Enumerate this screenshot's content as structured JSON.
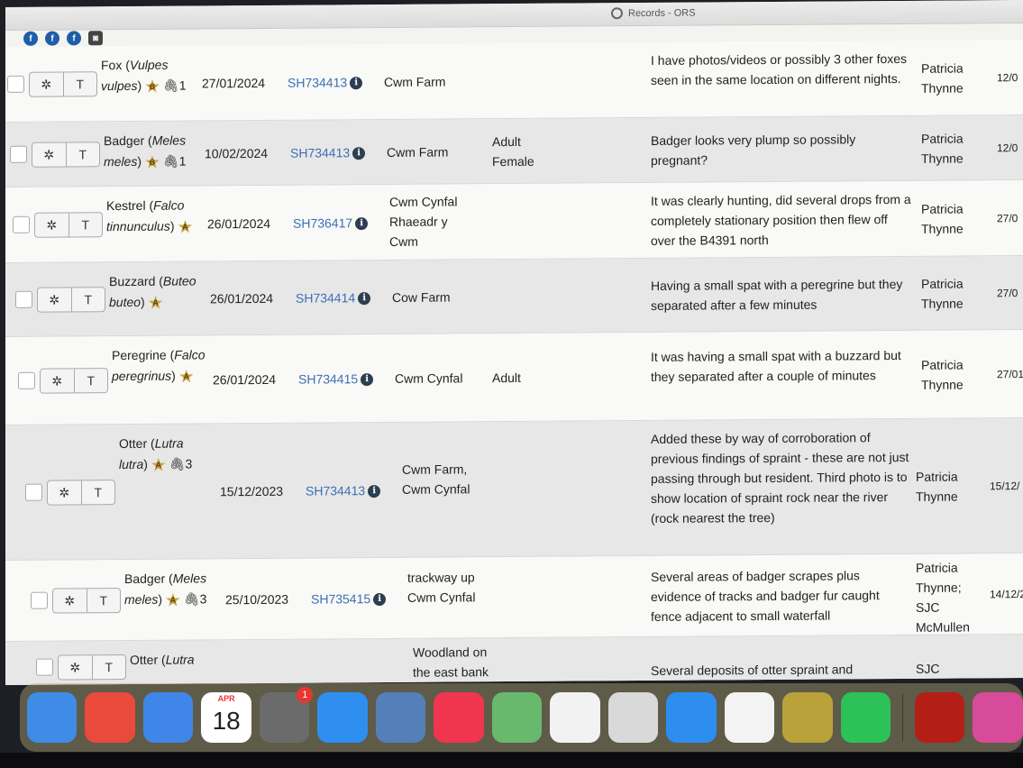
{
  "window": {
    "title": "Records - ORS"
  },
  "tabs": [
    {
      "icon": "circle-f-icon",
      "label": "f"
    },
    {
      "icon": "circle-f-icon",
      "label": "f"
    },
    {
      "icon": "circle-f-icon",
      "label": "f"
    },
    {
      "icon": "square-app-icon",
      "label": "◙"
    }
  ],
  "rows": [
    {
      "species_common": "Fox",
      "species_latin": "Vulpes vulpes",
      "rating": "B",
      "attachments": "1",
      "date": "27/01/2024",
      "gridref": "SH734413",
      "location": "Cwm Farm",
      "stage": "",
      "comment": "I have photos/videos or possibly 3 other foxes seen in the same location on different nights.",
      "recorder": "Patricia Thynne",
      "entered": "12/0"
    },
    {
      "species_common": "Badger",
      "species_latin": "Meles meles",
      "rating": "B",
      "attachments": "1",
      "date": "10/02/2024",
      "gridref": "SH734413",
      "location": "Cwm Farm",
      "stage": "Adult Female",
      "comment": "Badger looks very plump so possibly pregnant?",
      "recorder": "Patricia Thynne",
      "entered": "12/0"
    },
    {
      "species_common": "Kestrel",
      "species_latin": "Falco tinnunculus",
      "rating": "A",
      "attachments": "",
      "date": "26/01/2024",
      "gridref": "SH736417",
      "location": "Cwm Cynfal Rhaeadr y Cwm",
      "stage": "",
      "comment": "It was clearly hunting, did several drops from a completely stationary position then flew off over the B4391 north",
      "recorder": "Patricia Thynne",
      "entered": "27/0"
    },
    {
      "species_common": "Buzzard",
      "species_latin": "Buteo buteo",
      "rating": "A",
      "attachments": "",
      "date": "26/01/2024",
      "gridref": "SH734414",
      "location": "Cow Farm",
      "stage": "",
      "comment": "Having a small spat with a peregrine but they separated after a few minutes",
      "recorder": "Patricia Thynne",
      "entered": "27/0"
    },
    {
      "species_common": "Peregrine",
      "species_latin": "Falco peregrinus",
      "rating": "A",
      "attachments": "",
      "date": "26/01/2024",
      "gridref": "SH734415",
      "location": "Cwm Cynfal",
      "stage": "Adult",
      "comment": "It was having a small spat with a buzzard but they separated after a couple of minutes",
      "recorder": "Patricia Thynne",
      "entered": "27/01"
    },
    {
      "species_common": "Otter",
      "species_latin": "Lutra lutra",
      "rating": "A",
      "attachments": "3",
      "date": "15/12/2023",
      "gridref": "SH734413",
      "location": "Cwm Farm, Cwm Cynfal",
      "stage": "",
      "comment": "Added these by way of corroboration of previous findings of spraint - these are not just passing through but resident. Third photo is to show location of spraint rock near the river (rock nearest the tree)",
      "recorder": "Patricia Thynne",
      "entered": "15/12/"
    },
    {
      "species_common": "Badger",
      "species_latin": "Meles meles",
      "rating": "A",
      "attachments": "3",
      "date": "25/10/2023",
      "gridref": "SH735415",
      "location": "trackway up Cwm Cynfal",
      "stage": "",
      "comment": "Several areas of badger scrapes plus evidence of tracks and badger fur caught fence adjacent to small waterfall",
      "recorder": "Patricia Thynne; SJC McMullen",
      "entered": "14/12/2"
    },
    {
      "species_common": "Otter",
      "species_latin": "Lutra",
      "rating": "",
      "attachments": "",
      "date": "",
      "gridref": "",
      "location": "Woodland on the east bank",
      "stage": "",
      "comment": "Several deposits of otter spraint and",
      "recorder": "SJC",
      "entered": ""
    }
  ],
  "row_actions": {
    "settings_glyph": "✲",
    "filter_glyph": "T",
    "attachment_glyph": "🖇",
    "info_glyph": "i"
  },
  "dock": {
    "apps": [
      {
        "name": "Finder",
        "icon": "finder-icon",
        "color": "#3e8ce6"
      },
      {
        "name": "Chrome",
        "icon": "chrome-icon",
        "color": "#ea4a3b"
      },
      {
        "name": "Mail",
        "icon": "mail-icon",
        "color": "#3f86e8"
      },
      {
        "name": "Calendar",
        "icon": "calendar-icon",
        "color": "#ffffff",
        "month": "APR",
        "day": "18"
      },
      {
        "name": "System Settings",
        "icon": "settings-icon",
        "color": "#6b6b6b",
        "badge": "1"
      },
      {
        "name": "Safari",
        "icon": "safari-icon",
        "color": "#2f8ff0"
      },
      {
        "name": "Preview",
        "icon": "preview-icon",
        "color": "#557fb8"
      },
      {
        "name": "Music",
        "icon": "music-icon",
        "color": "#f0364e"
      },
      {
        "name": "Maps",
        "icon": "maps-icon",
        "color": "#68b96d"
      },
      {
        "name": "Freeform",
        "icon": "freeform-icon",
        "color": "#f2f2f2"
      },
      {
        "name": "Launchpad",
        "icon": "launchpad-icon",
        "color": "#d9d9d9"
      },
      {
        "name": "App Store",
        "icon": "app-store-icon",
        "color": "#2d8ef0"
      },
      {
        "name": "Photos",
        "icon": "photos-icon",
        "color": "#f3f3f3"
      },
      {
        "name": "Unknown",
        "icon": "app-icon",
        "color": "#b9a23a"
      },
      {
        "name": "WhatsApp",
        "icon": "whatsapp-icon",
        "color": "#2dc258"
      },
      {
        "name": "Acrobat",
        "icon": "acrobat-icon",
        "color": "#b31f17"
      },
      {
        "name": "Presentation",
        "icon": "presentation-icon",
        "color": "#d84b9a"
      }
    ]
  }
}
